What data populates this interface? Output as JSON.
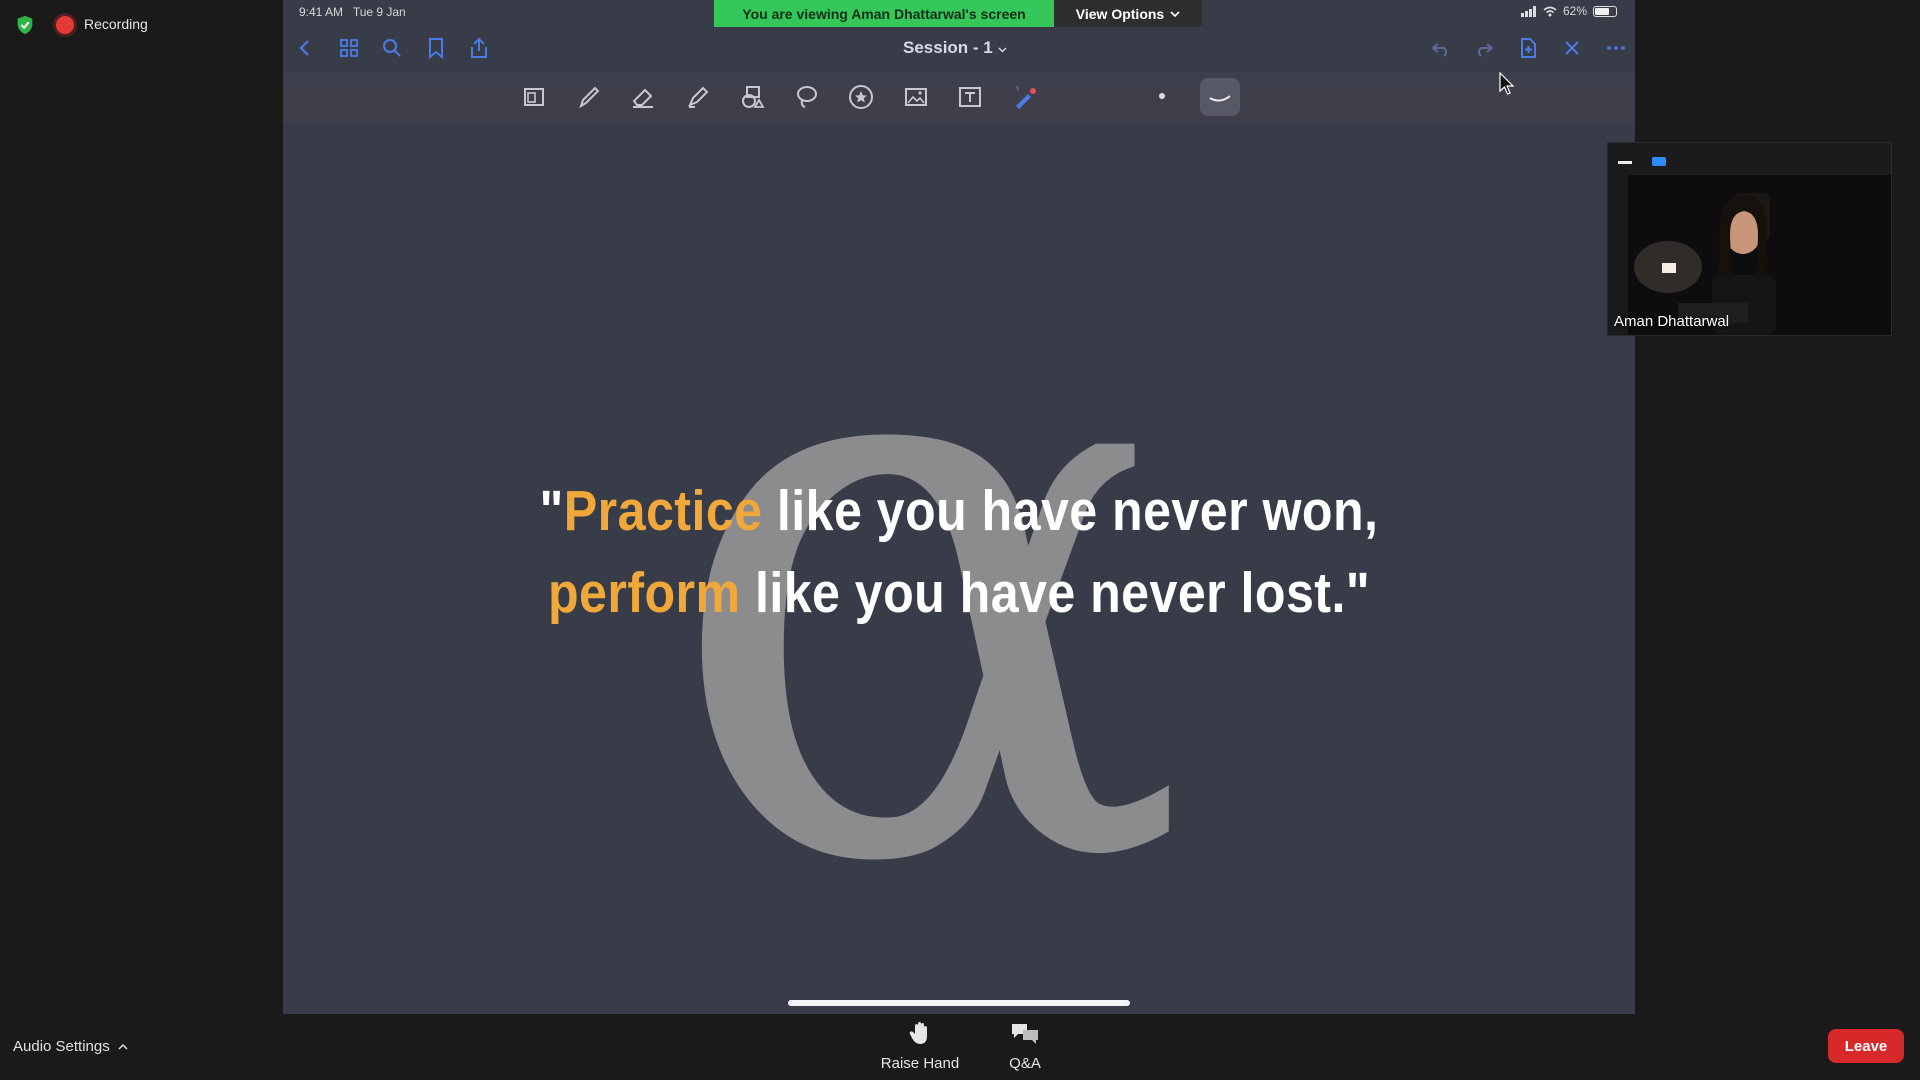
{
  "recording": {
    "label": "Recording"
  },
  "ipad_status": {
    "time": "9:41 AM   Tue 9 Jan",
    "battery": "62%"
  },
  "banner": {
    "text": "You are viewing Aman Dhattarwal's screen",
    "view_options": "View Options"
  },
  "notes_app": {
    "title": "Session - 1"
  },
  "slide": {
    "q1_open": "\"",
    "q1_highlight": "Practice",
    "q1_rest": " like you have never won,",
    "q2_highlight": "perform",
    "q2_rest": " like you have never lost.\""
  },
  "video": {
    "participant_name": "Aman Dhattarwal"
  },
  "bottom": {
    "audio_settings": "Audio Settings",
    "raise_hand": "Raise Hand",
    "qa": "Q&A",
    "leave": "Leave"
  },
  "colors": {
    "banner": "#35c75a",
    "accent": "#f1a83a",
    "leave": "#d8292a",
    "screen_bg": "#383c49"
  }
}
